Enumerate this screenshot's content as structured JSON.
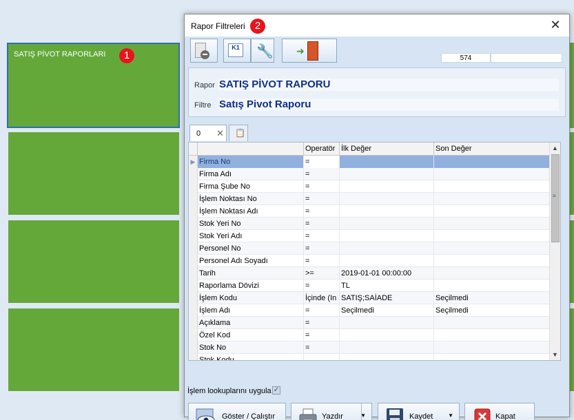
{
  "background_tiles": {
    "tile_1": {
      "label": "SATIŞ PİVOT RAPORLARI",
      "badge": "1"
    }
  },
  "dialog": {
    "title": "Rapor Filtreleri",
    "badge": "2",
    "close_icon": "close-icon",
    "toolbar": {
      "icons": [
        "document-remove-icon",
        "k1-user-icon",
        "wrench-icon",
        "exit-door-icon"
      ],
      "counter": "574"
    },
    "info": {
      "rapor_label": "Rapor",
      "rapor_value": "SATIŞ PİVOT RAPORU",
      "filtre_label": "Filtre",
      "filtre_value": "Satış Pivot Raporu"
    },
    "tabs": {
      "active_label": "0"
    },
    "grid": {
      "columns": [
        "",
        "Operatör",
        "İlk Değer",
        "Son Değer"
      ],
      "rows": [
        {
          "name": "Firma No",
          "op": "=",
          "first": "",
          "last": ""
        },
        {
          "name": "Firma Adı",
          "op": "=",
          "first": "",
          "last": ""
        },
        {
          "name": "Firma Şube No",
          "op": "=",
          "first": "",
          "last": ""
        },
        {
          "name": "İşlem Noktası No",
          "op": "=",
          "first": "",
          "last": ""
        },
        {
          "name": "İşlem Noktası Adı",
          "op": "=",
          "first": "",
          "last": ""
        },
        {
          "name": "Stok Yeri No",
          "op": "=",
          "first": "",
          "last": ""
        },
        {
          "name": "Stok Yeri Adı",
          "op": "=",
          "first": "",
          "last": ""
        },
        {
          "name": "Personel No",
          "op": "=",
          "first": "",
          "last": ""
        },
        {
          "name": "Personel Adı Soyadı",
          "op": "=",
          "first": "",
          "last": ""
        },
        {
          "name": "Tarih",
          "op": ">=",
          "first": "2019-01-01 00:00:00",
          "last": ""
        },
        {
          "name": "Raporlama Dövizi",
          "op": "=",
          "first": "TL",
          "last": ""
        },
        {
          "name": "İşlem Kodu",
          "op": "İçinde (In",
          "first": "SATIŞ;SAİADE",
          "last": "Seçilmedi"
        },
        {
          "name": "İşlem Adı",
          "op": "=",
          "first": "Seçilmedi",
          "last": "Seçilmedi"
        },
        {
          "name": "Açıklama",
          "op": "=",
          "first": "",
          "last": ""
        },
        {
          "name": "Özel Kod",
          "op": "=",
          "first": "",
          "last": ""
        },
        {
          "name": "Stok No",
          "op": "=",
          "first": "",
          "last": ""
        },
        {
          "name": "Stok Kodu",
          "op": "",
          "first": "",
          "last": ""
        }
      ]
    },
    "lookup_label": "İşlem lookuplarını uygula",
    "lookup_checked": true,
    "buttons": {
      "show": "Göster / Çalıştır",
      "print": "Yazdır",
      "save": "Kaydet",
      "close": "Kapat"
    }
  }
}
